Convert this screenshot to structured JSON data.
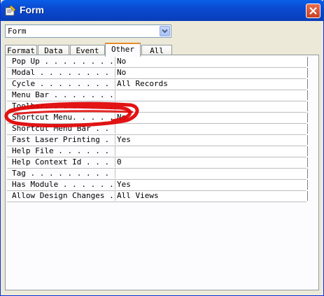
{
  "window": {
    "title": "Form"
  },
  "object_selector": {
    "value": "Form"
  },
  "tabs": [
    {
      "label": "Format",
      "active": false
    },
    {
      "label": "Data",
      "active": false
    },
    {
      "label": "Event",
      "active": false
    },
    {
      "label": "Other",
      "active": true
    },
    {
      "label": "All",
      "active": false
    }
  ],
  "properties": [
    {
      "name": "Pop Up . . . . . . . . .",
      "value": "No"
    },
    {
      "name": "Modal . . . . . . . . .",
      "value": "No"
    },
    {
      "name": "Cycle . . . . . . . . .",
      "value": "All Records"
    },
    {
      "name": "Menu Bar . . . . . . . .",
      "value": ""
    },
    {
      "name": "Toolbar. . . . . . . . .",
      "value": ""
    },
    {
      "name": "Shortcut Menu. . . . . .",
      "value": "No"
    },
    {
      "name": "Shortcut Menu Bar . . .",
      "value": ""
    },
    {
      "name": "Fast Laser Printing . .",
      "value": "Yes"
    },
    {
      "name": "Help File . . . . . . .",
      "value": ""
    },
    {
      "name": "Help Context Id . . . .",
      "value": "0"
    },
    {
      "name": "Tag . . . . . . . . . .",
      "value": ""
    },
    {
      "name": "Has Module . . . . . .",
      "value": "Yes"
    },
    {
      "name": "Allow Design Changes . .",
      "value": "All Views"
    }
  ],
  "icons": {
    "title": "properties-icon",
    "close": "close-icon",
    "dropdown": "chevron-down-icon"
  },
  "colors": {
    "titlebar": "#0a4ad0",
    "active_tab_accent": "#e68b2c",
    "annotation": "#e00000"
  }
}
